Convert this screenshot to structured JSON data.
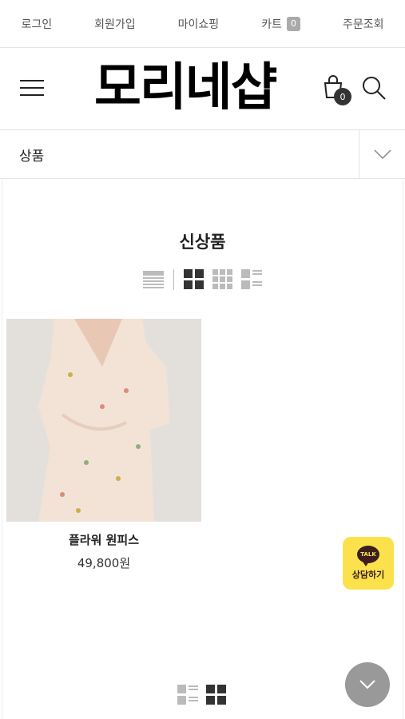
{
  "topbar": {
    "login": "로그인",
    "signup": "회원가입",
    "myshopping": "마이쇼핑",
    "cart": "카트",
    "cart_count": "0",
    "order_lookup": "주문조회"
  },
  "header": {
    "logo": "모리네샵",
    "bag_count": "0"
  },
  "category": {
    "label": "상품"
  },
  "section": {
    "title": "신상품"
  },
  "products": [
    {
      "name": "플라워 원피스",
      "price": "49,800원"
    }
  ],
  "chat": {
    "talk": "TALK",
    "label": "상담하기"
  },
  "colors": {
    "accent": "#fbe24c",
    "text": "#222222",
    "border": "#e4e4e4"
  }
}
